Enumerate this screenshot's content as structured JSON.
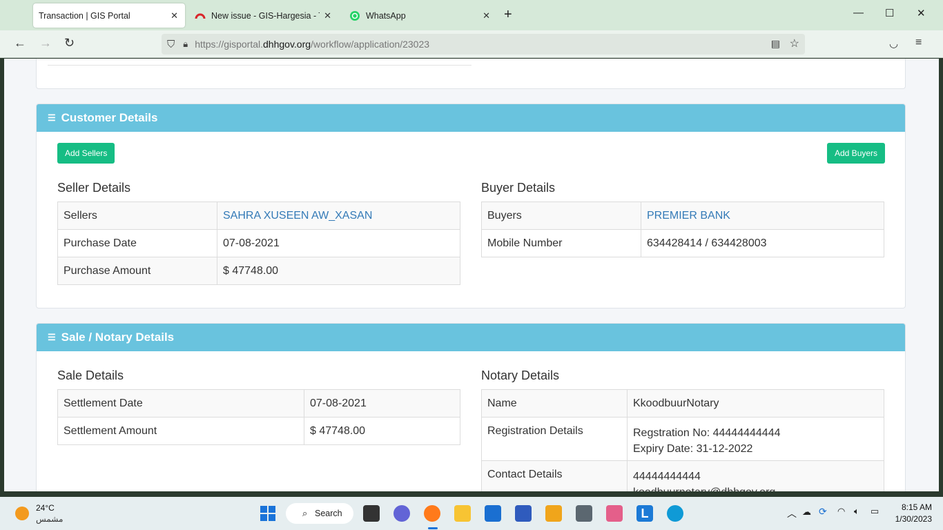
{
  "browser": {
    "tabs": [
      {
        "title": "Transaction | GIS Portal",
        "active": true
      },
      {
        "title": "New issue - GIS-Hargesia - Team",
        "active": false
      },
      {
        "title": "WhatsApp",
        "active": false
      }
    ],
    "url": {
      "prefix": "https://gisportal.",
      "domain": "dhhgov.org",
      "path": "/workflow/application/23023"
    }
  },
  "customer": {
    "header": "Customer Details",
    "add_sellers": "Add Sellers",
    "add_buyers": "Add Buyers",
    "seller": {
      "title": "Seller Details",
      "rows": [
        {
          "label": "Sellers",
          "value": "SAHRA XUSEEN AW_XASAN"
        },
        {
          "label": "Purchase Date",
          "value": "07-08-2021"
        },
        {
          "label": "Purchase Amount",
          "value": "$ 47748.00"
        }
      ]
    },
    "buyer": {
      "title": "Buyer Details",
      "rows": [
        {
          "label": "Buyers",
          "value": "PREMIER BANK"
        },
        {
          "label": "Mobile Number",
          "value": "634428414 / 634428003"
        }
      ]
    }
  },
  "sale": {
    "header": "Sale / Notary Details",
    "sale_details": {
      "title": "Sale Details",
      "rows": [
        {
          "label": "Settlement Date",
          "value": "07-08-2021"
        },
        {
          "label": "Settlement Amount",
          "value": "$ 47748.00"
        }
      ]
    },
    "notary": {
      "title": "Notary Details",
      "name_label": "Name",
      "name_value": "KkoodbuurNotary",
      "reg_label": "Registration Details",
      "reg_no": "Regstration No: 44444444444",
      "expiry": "Expiry Date: 31-12-2022",
      "contact_label": "Contact Details",
      "contact_phone": "44444444444",
      "contact_email": "koodbuurnotary@dhhgov.org"
    }
  },
  "taskbar": {
    "weather_temp": "24°C",
    "weather_desc": "مشمس",
    "search": "Search",
    "time": "8:15 AM",
    "date": "1/30/2023"
  }
}
